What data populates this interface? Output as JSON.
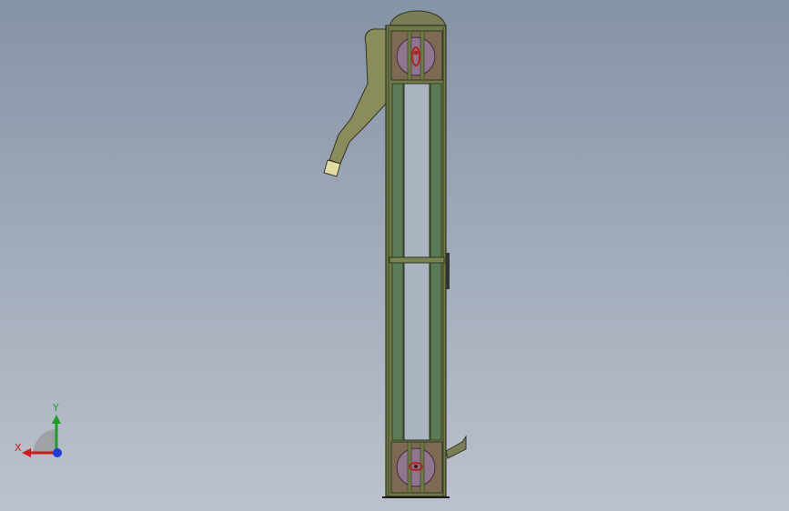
{
  "viewport": {
    "background_top": "#8593a6",
    "background_bottom": "#bcc2cd"
  },
  "model": {
    "name": "bucket-elevator",
    "colors": {
      "frame": "#6f7a48",
      "frame_dark": "#3e4526",
      "belt": "#5a7a55",
      "housing": "#7e6a52",
      "pulley": "#8f7590",
      "chute": "#8a8c5c",
      "inlet": "#e3dca4",
      "detail_red": "#b2251f"
    }
  },
  "triad": {
    "x_label": "X",
    "y_label": "Y",
    "x_color": "#c81e1e",
    "y_color": "#1c9c2a",
    "z_color": "#1f3bd6"
  }
}
